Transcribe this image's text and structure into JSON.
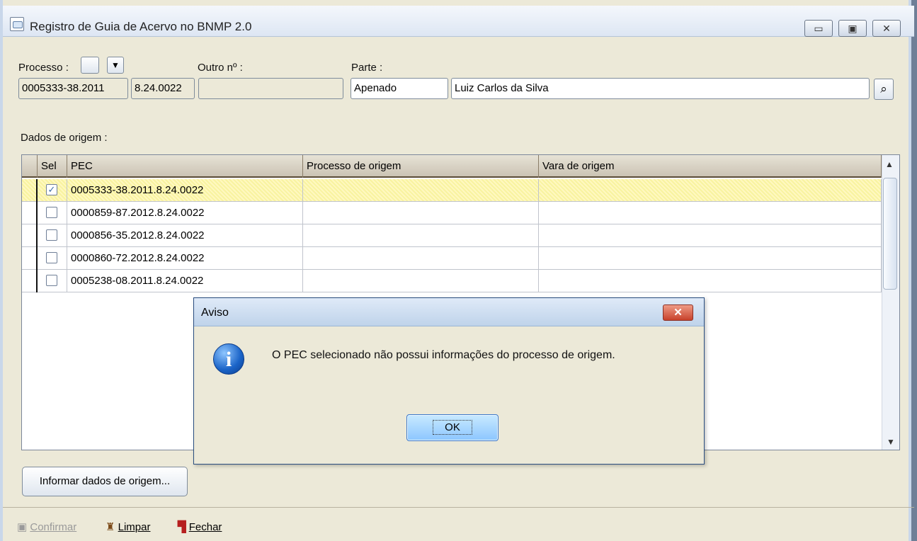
{
  "window": {
    "title": "Registro de Guia de Acervo no BNMP 2.0",
    "controls": {
      "minimize": "▭",
      "maximize": "▣",
      "close": "✕"
    }
  },
  "form": {
    "processo_label": "Processo :",
    "processo_number": "0005333-38.2011",
    "processo_suffix": "8.24.0022",
    "outro_label": "Outro nº :",
    "outro_value": "",
    "parte_label": "Parte :",
    "parte_type": "Apenado",
    "parte_name": "Luiz Carlos da Silva",
    "dados_label": "Dados de origem :"
  },
  "grid": {
    "headers": [
      "Sel",
      "PEC",
      "Processo de origem",
      "Vara de origem"
    ],
    "rows": [
      {
        "checked": true,
        "pec": "0005333-38.2011.8.24.0022",
        "processo": "",
        "vara": ""
      },
      {
        "checked": false,
        "pec": "0000859-87.2012.8.24.0022",
        "processo": "",
        "vara": ""
      },
      {
        "checked": false,
        "pec": "0000856-35.2012.8.24.0022",
        "processo": "",
        "vara": ""
      },
      {
        "checked": false,
        "pec": "0000860-72.2012.8.24.0022",
        "processo": "",
        "vara": ""
      },
      {
        "checked": false,
        "pec": "0005238-08.2011.8.24.0022",
        "processo": "",
        "vara": ""
      }
    ]
  },
  "buttons": {
    "informar": "Informar dados de origem...",
    "confirmar": "Confirmar",
    "limpar": "Limpar",
    "fechar": "Fechar"
  },
  "dialog": {
    "title": "Aviso",
    "message": "O PEC selecionado não possui informações do processo de origem.",
    "ok": "OK",
    "close": "✕"
  },
  "icons": {
    "app": "window-icon",
    "search": "search-icon",
    "info": "info-icon"
  },
  "colors": {
    "window": "#ece9d8",
    "selected_row": "#fff8c0",
    "dialog_button": "#8cc6ff"
  }
}
